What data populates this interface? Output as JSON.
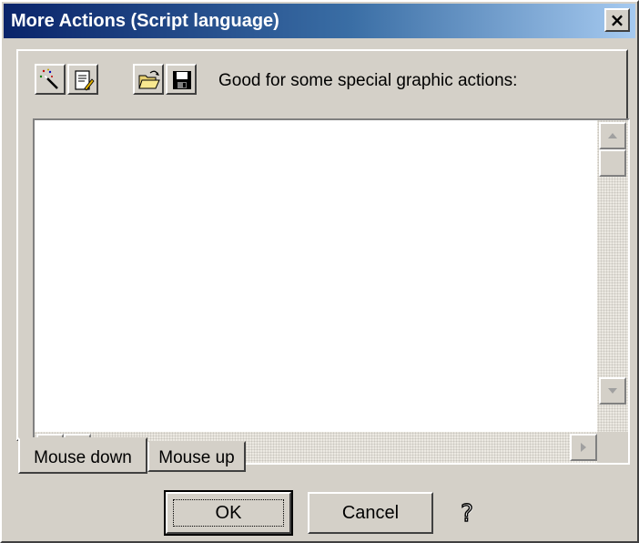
{
  "window": {
    "title": "More Actions (Script language)",
    "close_label": "×"
  },
  "toolbar": {
    "buttons": [
      {
        "icon": "magic-wand-icon",
        "name": "wizard-button"
      },
      {
        "icon": "edit-document-icon",
        "name": "edit-button"
      },
      {
        "icon": "open-folder-icon",
        "name": "open-button"
      },
      {
        "icon": "floppy-disk-icon",
        "name": "save-button"
      }
    ],
    "label": "Good for some special graphic actions:"
  },
  "editor": {
    "content": ""
  },
  "tabs": [
    {
      "label": "Mouse down",
      "active": true
    },
    {
      "label": "Mouse up",
      "active": false
    }
  ],
  "buttons": {
    "ok_label": "OK",
    "cancel_label": "Cancel",
    "help_glyph": "?"
  },
  "colors": {
    "titlebar_start": "#0a246a",
    "titlebar_end": "#a6caf0",
    "face": "#d4d0c8"
  }
}
